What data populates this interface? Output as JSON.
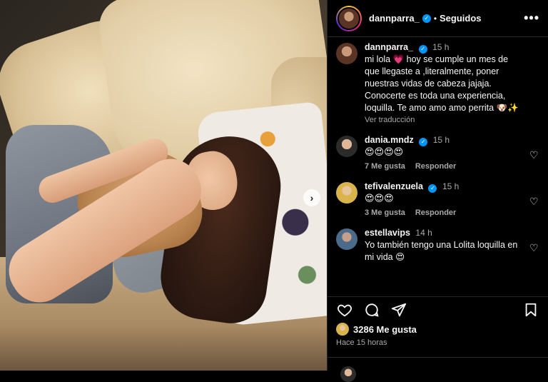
{
  "header": {
    "username": "dannparra_",
    "separator": "•",
    "follow_status": "Seguidos",
    "more_label": "•••"
  },
  "caption": {
    "username": "dannparra_",
    "time": "15 h",
    "text": "mi lola 💗 hoy se cumple un mes de que llegaste a ,literalmente, poner nuestras vidas de cabeza jajaja. Conocerte es toda una experiencia, loquilla. Te amo amo amo perrita 🐶✨",
    "see_translation": "Ver traducción"
  },
  "comments": [
    {
      "username": "dania.mndz",
      "verified": true,
      "time": "15 h",
      "text": "😍😍😍😍",
      "likes": "7 Me gusta",
      "reply": "Responder"
    },
    {
      "username": "tefivalenzuela",
      "verified": true,
      "time": "15 h",
      "text": "😍😍😍",
      "likes": "3 Me gusta",
      "reply": "Responder"
    },
    {
      "username": "estellavips",
      "verified": false,
      "time": "14 h",
      "text": "Yo también tengo una Lolita loquilla en mi vida 😍",
      "likes": "",
      "reply": ""
    }
  ],
  "likes": {
    "count": "3286 Me gusta"
  },
  "posted": "Hace 15 horas",
  "icons": {
    "verified": "verified-badge-icon",
    "heart": "heart-icon",
    "comment": "comment-icon",
    "share": "share-icon",
    "bookmark": "bookmark-icon",
    "next": "chevron-right-icon"
  },
  "colors": {
    "accent": "#0095f6",
    "background": "#000000",
    "muted": "#a8a8a8"
  }
}
